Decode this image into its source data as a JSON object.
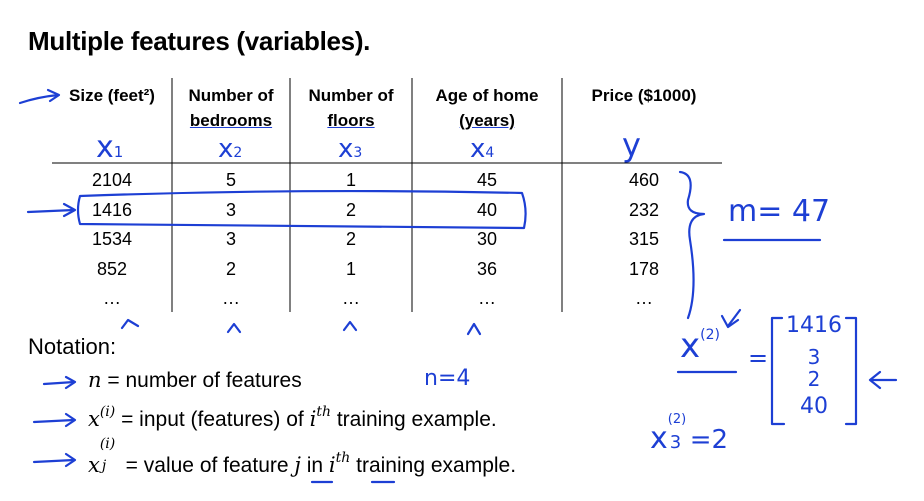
{
  "title": "Multiple features (variables).",
  "table": {
    "columns": [
      {
        "line1": "Size (feet²)",
        "line2": ""
      },
      {
        "line1": "Number of",
        "line2": "bedrooms"
      },
      {
        "line1": "Number of",
        "line2": "floors"
      },
      {
        "line1": "Age of home",
        "line2": "(years)"
      },
      {
        "line1": "Price ($1000)",
        "line2": ""
      }
    ],
    "rows": [
      [
        "2104",
        "5",
        "1",
        "45",
        "460"
      ],
      [
        "1416",
        "3",
        "2",
        "40",
        "232"
      ],
      [
        "1534",
        "3",
        "2",
        "30",
        "315"
      ],
      [
        "852",
        "2",
        "1",
        "36",
        "178"
      ],
      [
        "…",
        "…",
        "…",
        "…",
        "…"
      ]
    ]
  },
  "handwriting": {
    "col_symbols": {
      "x1": "x",
      "x1_sub": "1",
      "x2": "x",
      "x2_sub": "2",
      "x3": "x",
      "x3_sub": "3",
      "x4": "x",
      "x4_sub": "4",
      "y": "y"
    },
    "m_label": "m= 47",
    "n_label": "n=4",
    "x2_vec_base": "x",
    "x2_vec_sup": "(2)",
    "equals": "=",
    "vector": [
      "1416",
      "3",
      "2",
      "40"
    ],
    "x32_base": "x",
    "x32_sub": "3",
    "x32_sup": "(2)",
    "x32_rest": "=2"
  },
  "notation": {
    "title": "Notation:",
    "n_symbol": "n",
    "n_text": " = number of features",
    "x_base": "x",
    "x_sup": "(i)",
    "x_text": " = input (features) of ",
    "i_base": "i",
    "i_sup": "th",
    "x_tail": " training example.",
    "xj_base": "x",
    "xj_sup": "(i)",
    "xj_sub": "j",
    "xj_text": " = value of feature ",
    "j_symbol": "j",
    "in_text": " in ",
    "i2_base": "i",
    "i2_sup": "th",
    "xj_tail": " training example."
  }
}
